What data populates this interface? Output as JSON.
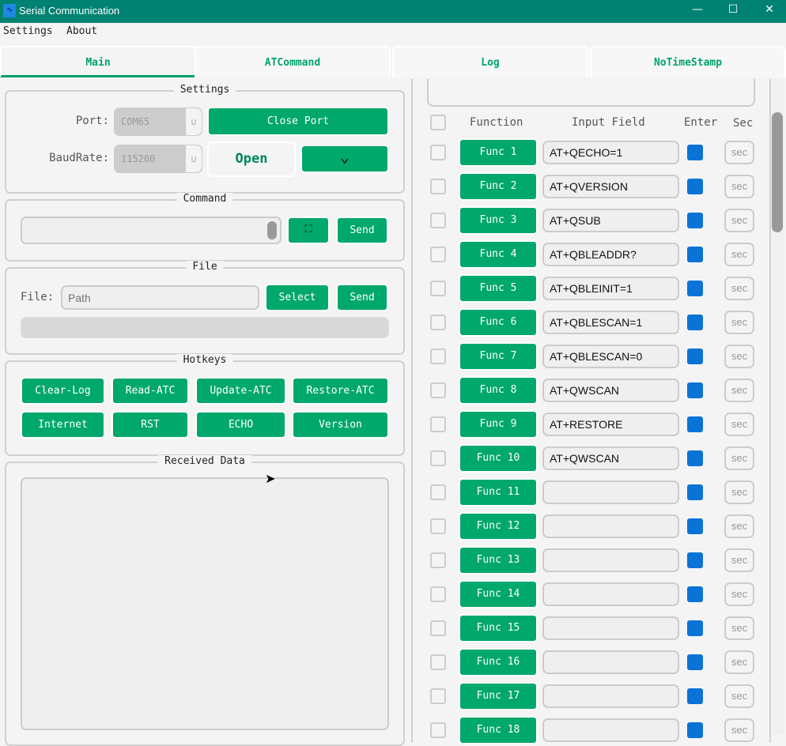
{
  "window": {
    "title": "Serial Communication",
    "minimize": "—",
    "maximize": "☐",
    "close": "✕"
  },
  "menu": [
    "Settings",
    "About"
  ],
  "tabs": [
    "Main",
    "ATCommand",
    "Log",
    "NoTimeStamp"
  ],
  "settings": {
    "title": "Settings",
    "port_label": "Port:",
    "port_value": "COM65",
    "baud_label": "BaudRate:",
    "baud_value": "115200",
    "close_port": "Close Port",
    "open": "Open",
    "dropdown": "⌄"
  },
  "command": {
    "title": "Command",
    "value": "",
    "send": "Send"
  },
  "file": {
    "title": "File",
    "label": "File:",
    "placeholder": "Path",
    "select": "Select",
    "send": "Send",
    "progress": 0
  },
  "hotkeys": {
    "title": "Hotkeys",
    "buttons": [
      "Clear-Log",
      "Read-ATC",
      "Update-ATC",
      "Restore-ATC",
      "Internet",
      "RST",
      "ECHO",
      "Version"
    ]
  },
  "received": {
    "title": "Received Data",
    "value": ""
  },
  "functions": {
    "headers": {
      "function": "Function",
      "input": "Input Field",
      "enter": "Enter",
      "sec": "Sec"
    },
    "sec_placeholder": "sec",
    "rows": [
      {
        "label": "Func 1",
        "value": "AT+QECHO=1"
      },
      {
        "label": "Func 2",
        "value": "AT+QVERSION"
      },
      {
        "label": "Func 3",
        "value": "AT+QSUB"
      },
      {
        "label": "Func 4",
        "value": "AT+QBLEADDR?"
      },
      {
        "label": "Func 5",
        "value": "AT+QBLEINIT=1"
      },
      {
        "label": "Func 6",
        "value": "AT+QBLESCAN=1"
      },
      {
        "label": "Func 7",
        "value": "AT+QBLESCAN=0"
      },
      {
        "label": "Func 8",
        "value": "AT+QWSCAN"
      },
      {
        "label": "Func 9",
        "value": "AT+RESTORE"
      },
      {
        "label": "Func 10",
        "value": "AT+QWSCAN"
      },
      {
        "label": "Func 11",
        "value": ""
      },
      {
        "label": "Func 12",
        "value": ""
      },
      {
        "label": "Func 13",
        "value": ""
      },
      {
        "label": "Func 14",
        "value": ""
      },
      {
        "label": "Func 15",
        "value": ""
      },
      {
        "label": "Func 16",
        "value": ""
      },
      {
        "label": "Func 17",
        "value": ""
      },
      {
        "label": "Func 18",
        "value": ""
      }
    ]
  }
}
